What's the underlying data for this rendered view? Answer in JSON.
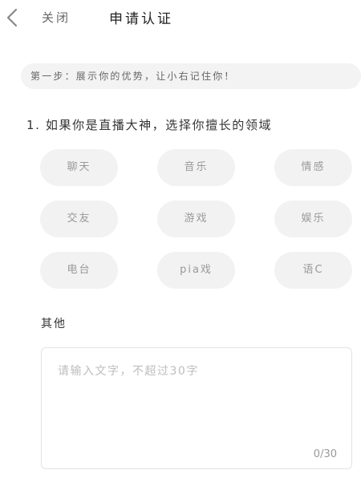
{
  "header": {
    "close_label": "关闭",
    "title": "申请认证"
  },
  "step": {
    "text": "第一步：展示你的优势，让小右记住你！"
  },
  "question": {
    "text": "1. 如果你是直播大神，选择你擅长的领域"
  },
  "fields": [
    {
      "label": "聊天"
    },
    {
      "label": "音乐"
    },
    {
      "label": "情感"
    },
    {
      "label": "交友"
    },
    {
      "label": "游戏"
    },
    {
      "label": "娱乐"
    },
    {
      "label": "电台"
    },
    {
      "label": "pia戏"
    },
    {
      "label": "语C"
    }
  ],
  "other": {
    "label": "其他",
    "placeholder": "请输入文字，不超过30字",
    "count": "0/30"
  },
  "colors": {
    "chip_bg": "#f2f2f2",
    "chip_text": "#999999",
    "banner_bg": "#f3f3f3"
  }
}
